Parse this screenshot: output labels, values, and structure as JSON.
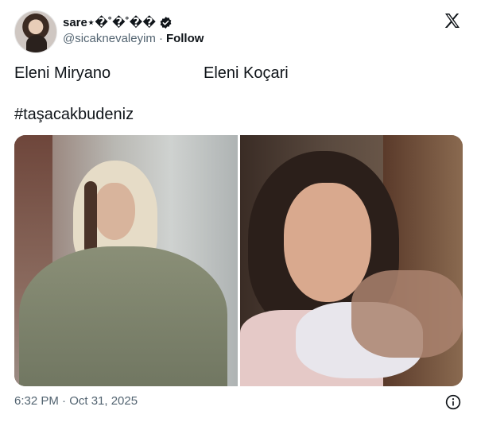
{
  "tweet": {
    "author": {
      "display_name": "sare⋆�˚�˚��",
      "handle": "@sicaknevaleyim",
      "separator": "·",
      "follow_label": "Follow"
    },
    "text": {
      "name_left": "Eleni Miryano",
      "name_right": "Eleni Koçari",
      "hashtag": "#taşacakbudeniz"
    },
    "timestamp": "6:32 PM · Oct 31, 2025"
  },
  "icons": {
    "verified": "verified-badge-icon",
    "brand": "x-logo-icon",
    "info": "info-icon"
  },
  "colors": {
    "text_primary": "#0f1419",
    "text_secondary": "#536471",
    "background": "#ffffff"
  }
}
